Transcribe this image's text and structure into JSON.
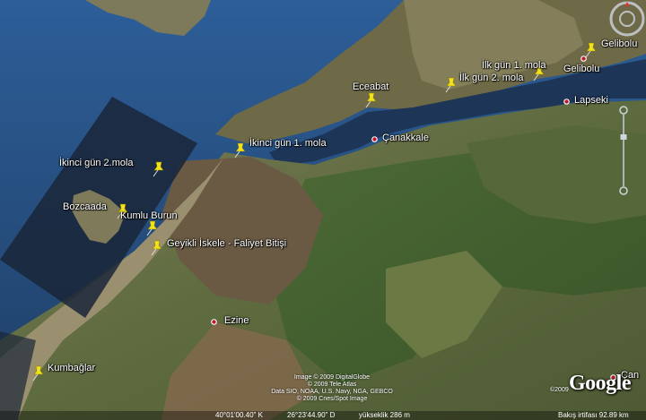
{
  "places": [
    {
      "id": "gelibolu-pin",
      "label": "Gelibolu",
      "kind": "pin"
    },
    {
      "id": "gelibolu-town",
      "label": "Gelibolu",
      "kind": "town"
    },
    {
      "id": "ilk-gun-1",
      "label": "İlk gün 1. mola",
      "kind": "pin"
    },
    {
      "id": "ilk-gun-2",
      "label": "İlk gün 2. mola",
      "kind": "pin"
    },
    {
      "id": "lapseki",
      "label": "Lapseki",
      "kind": "town"
    },
    {
      "id": "eceabat",
      "label": "Eceabat",
      "kind": "pin"
    },
    {
      "id": "ikinci-gun-1",
      "label": "İkinci gün 1. mola",
      "kind": "pin"
    },
    {
      "id": "canakkale",
      "label": "Çanakkale",
      "kind": "town"
    },
    {
      "id": "ikinci-gun-2",
      "label": "İkinci gün 2.mola",
      "kind": "pin"
    },
    {
      "id": "bozcaada",
      "label": "Bozcaada",
      "kind": "text"
    },
    {
      "id": "kumlu-burun",
      "label": "Kumlu Burun",
      "kind": "pin"
    },
    {
      "id": "geyikli",
      "label": "Geyikli İskele - Faliyet Bitişi",
      "kind": "pin"
    },
    {
      "id": "ezine",
      "label": "Ezine",
      "kind": "town"
    },
    {
      "id": "kumbaglar",
      "label": "Kumbağlar",
      "kind": "pin"
    },
    {
      "id": "can",
      "label": "Çan",
      "kind": "town"
    }
  ],
  "attribution": {
    "line1": "Image © 2009 DigitalGlobe",
    "line2": "© 2009 Tele Atlas",
    "line3": "Data SIO, NOAA, U.S. Navy, NGA, GEBCO",
    "line4": "© 2009 Cnes/Spot Image",
    "copyright": "©2009",
    "logo": "Google"
  },
  "status": {
    "lat": "40°01'00.40\" K",
    "lon": "26°23'44.90\" D",
    "elevation": "yükseklik  286 m",
    "eye_alt": "Bakış irtifası    92.89 km"
  },
  "colors": {
    "sea": "#2f5b8a",
    "land_light": "#8a8f6a",
    "land_forest": "#3e5a2e",
    "pin": "#f2e21a",
    "town_dot": "#c0182a"
  },
  "icons": {
    "pin": "pushpin-icon",
    "town": "town-dot-icon",
    "compass": "compass-icon",
    "zoom": "zoom-slider-icon"
  }
}
